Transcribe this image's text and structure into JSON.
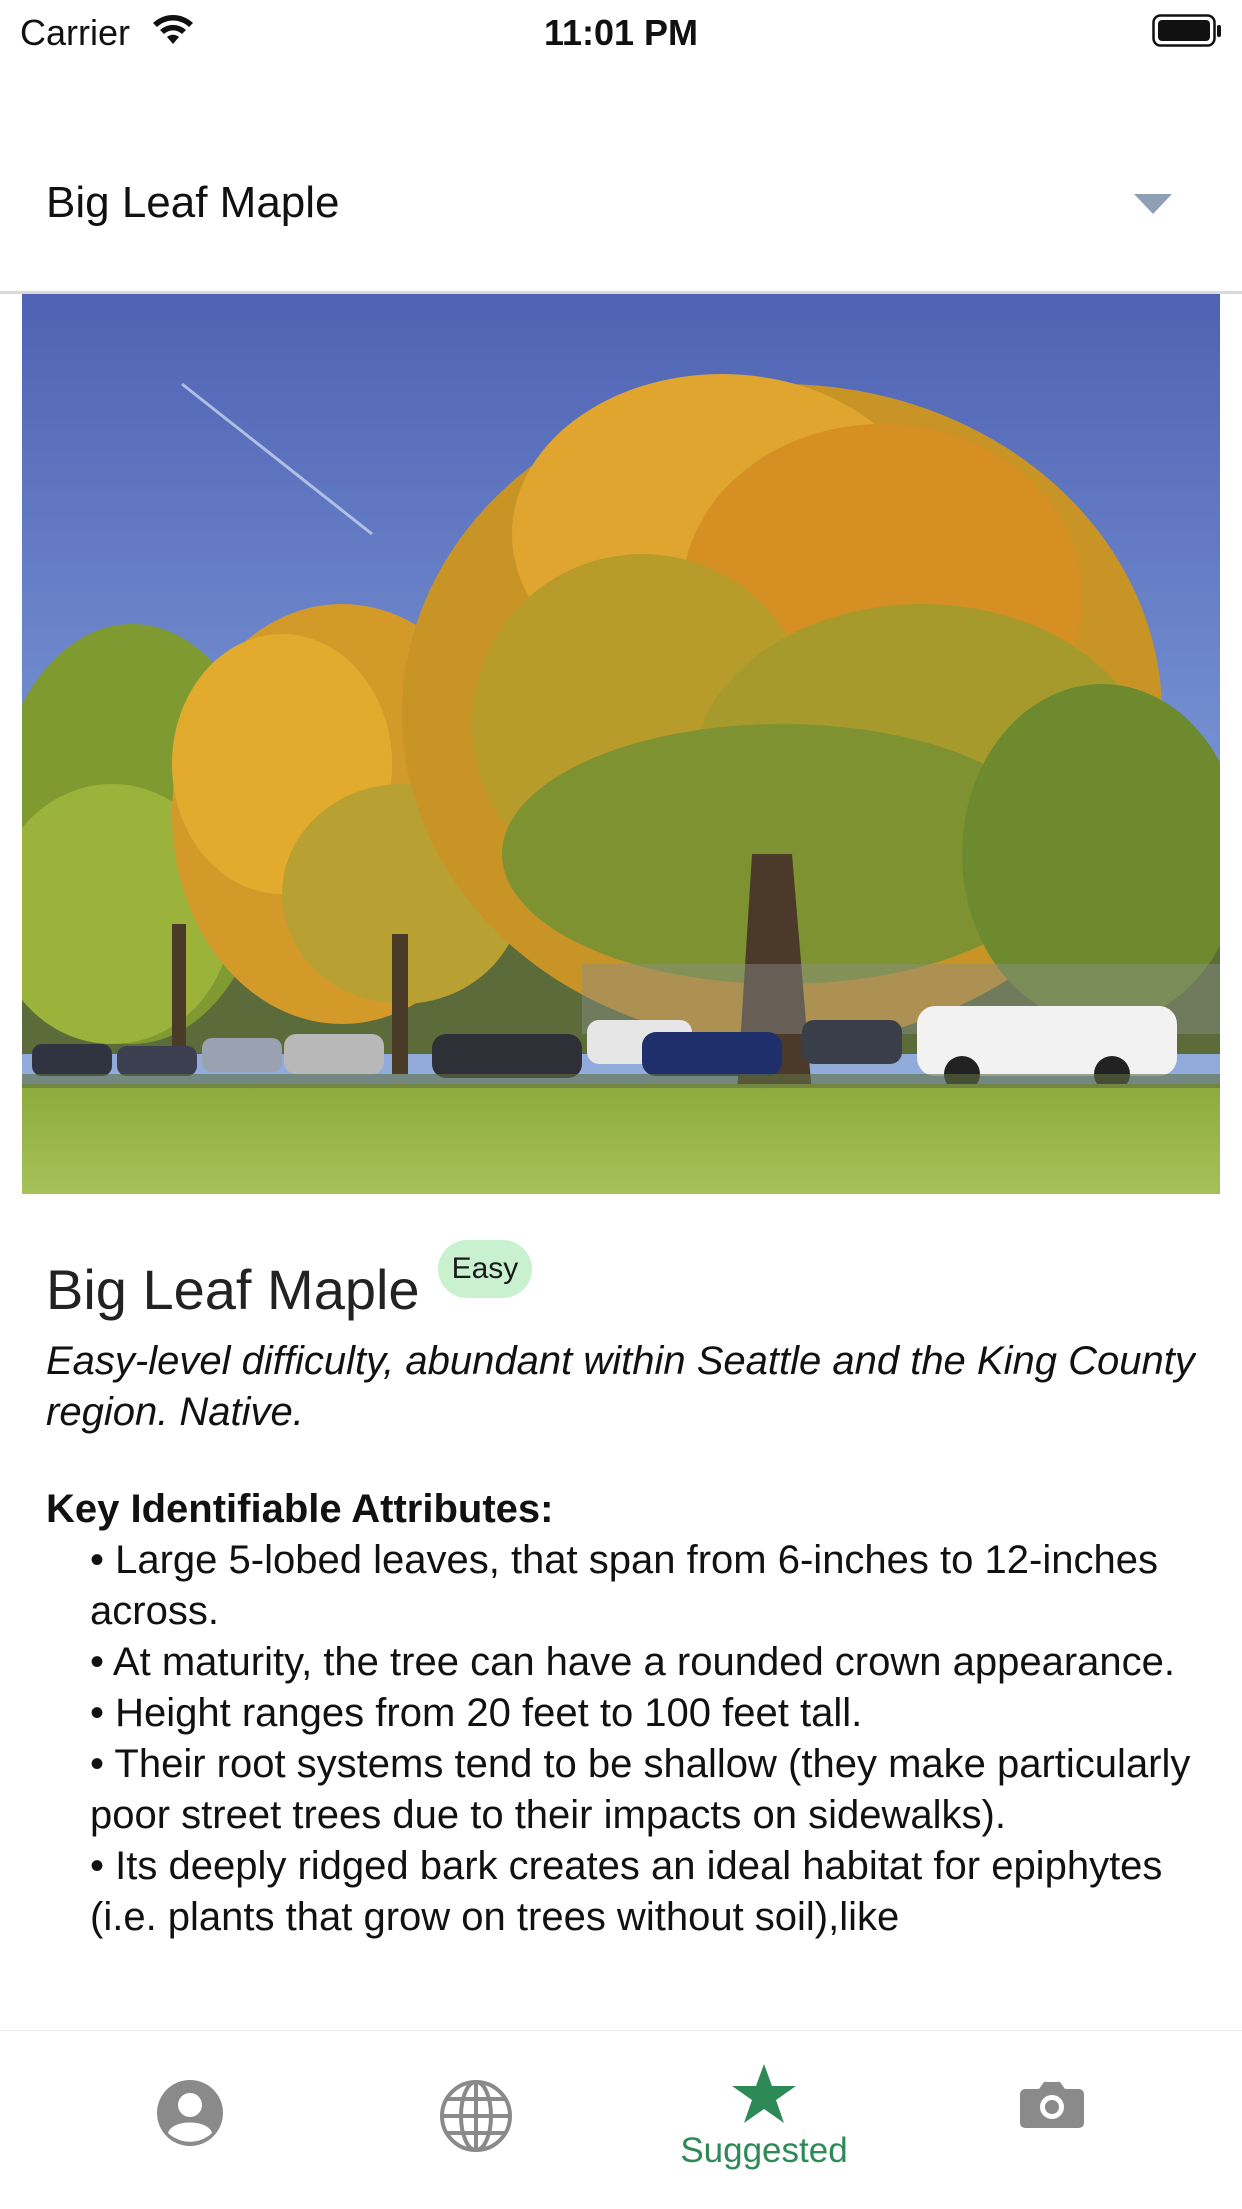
{
  "status_bar": {
    "carrier": "Carrier",
    "time": "11:01 PM"
  },
  "selector": {
    "value": "Big Leaf Maple",
    "icon": "chevron-down-icon"
  },
  "tree": {
    "title": "Big Leaf Maple",
    "difficulty_badge": "Easy",
    "summary": "Easy-level difficulty, abundant within Seattle and the King County region. Native.",
    "attributes_heading": "Key Identifiable Attributes:",
    "attributes": [
      "• Large 5-lobed leaves, that span from 6-inches to 12-inches across.",
      "• At maturity, the tree can have a rounded crown appearance.",
      "• Height ranges from 20 feet to 100 feet tall.",
      "• Their root systems tend to be shallow (they make particularly poor street trees due to their impacts on sidewalks).",
      "• Its deeply ridged bark creates an ideal habitat for epiphytes (i.e. plants that grow on trees without soil),like"
    ]
  },
  "tab_bar": {
    "tabs": [
      {
        "icon": "profile-icon",
        "label": ""
      },
      {
        "icon": "globe-icon",
        "label": ""
      },
      {
        "icon": "star-icon",
        "label": "Suggested"
      },
      {
        "icon": "camera-icon",
        "label": ""
      }
    ],
    "active_color": "#2d8a57",
    "inactive_color": "#8a8a8a"
  },
  "colors": {
    "badge_background": "#c9f1d0",
    "accent": "#2d8a57"
  }
}
